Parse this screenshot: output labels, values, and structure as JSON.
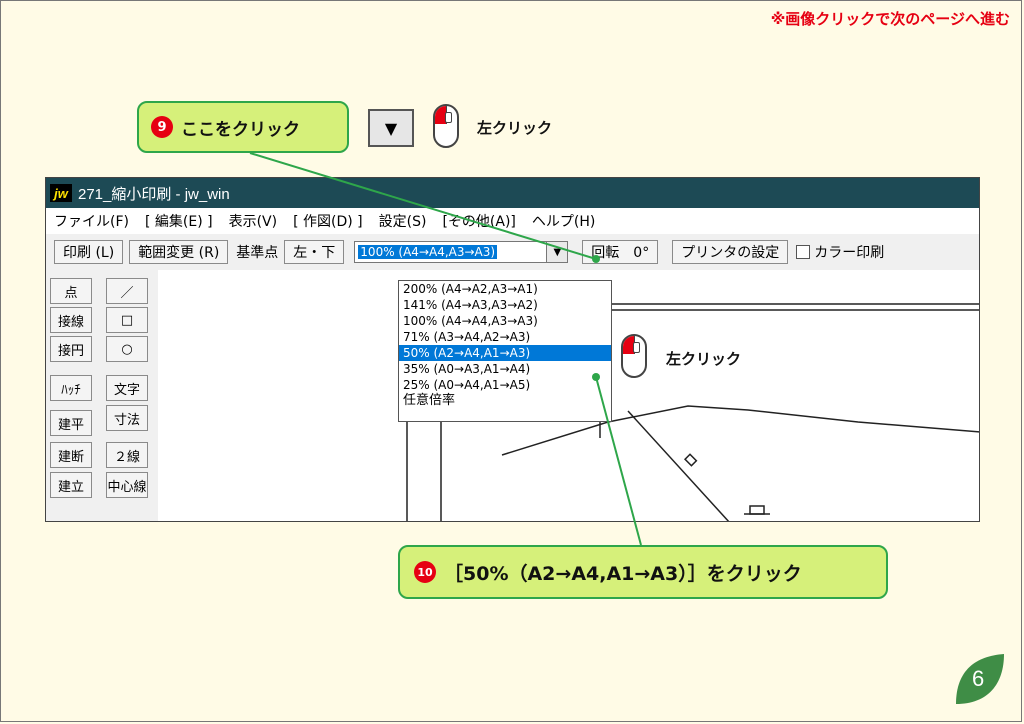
{
  "page": {
    "top_note": "※画像クリックで次のページへ進む",
    "page_number": "6"
  },
  "callouts": {
    "step9": {
      "number": "9",
      "text": "ここをクリック"
    },
    "step10": {
      "number": "10",
      "text": "［50%（A2→A4,A1→A3）］をクリック"
    }
  },
  "hints": {
    "left_click_1": "左クリック",
    "left_click_2": "左クリック"
  },
  "window": {
    "title": "271_縮小印刷 - jw_win",
    "icon_text": "jw"
  },
  "menu": [
    "ファイル(F)",
    "[ 編集(E) ]",
    "表示(V)",
    "[ 作図(D) ]",
    "設定(S)",
    "[その他(A)]",
    "ヘルプ(H)"
  ],
  "toolbar": {
    "print": "印刷 (L)",
    "range_change": "範囲変更 (R)",
    "base_point_label": "基準点",
    "base_point_value": "左・下",
    "scale_selected": "100% (A4→A4,A3→A3)",
    "rotate": "回転　0°",
    "printer_settings": "プリンタの設定",
    "color_print": "カラー印刷"
  },
  "dropdown_options": [
    "200% (A4→A2,A3→A1)",
    "141% (A4→A3,A3→A2)",
    "100% (A4→A4,A3→A3)",
    " 71% (A3→A4,A2→A3)",
    " 50% (A2→A4,A1→A3)",
    " 35% (A0→A3,A1→A4)",
    " 25% (A0→A4,A1→A5)",
    "任意倍率"
  ],
  "dropdown_selected_index": 4,
  "left_tools": {
    "col1": [
      "点",
      "接線",
      "接円",
      "ﾊｯﾁ",
      "建平",
      "建断",
      "建立"
    ],
    "col2": [
      "／",
      "□",
      "○",
      "文字",
      "寸法",
      "２線",
      "中心線"
    ]
  },
  "colors": {
    "callout_fill": "#d6f07a",
    "callout_border": "#2ea64a",
    "accent_red": "#e60012",
    "titlebar": "#1d4a55",
    "selection": "#0078d7"
  }
}
